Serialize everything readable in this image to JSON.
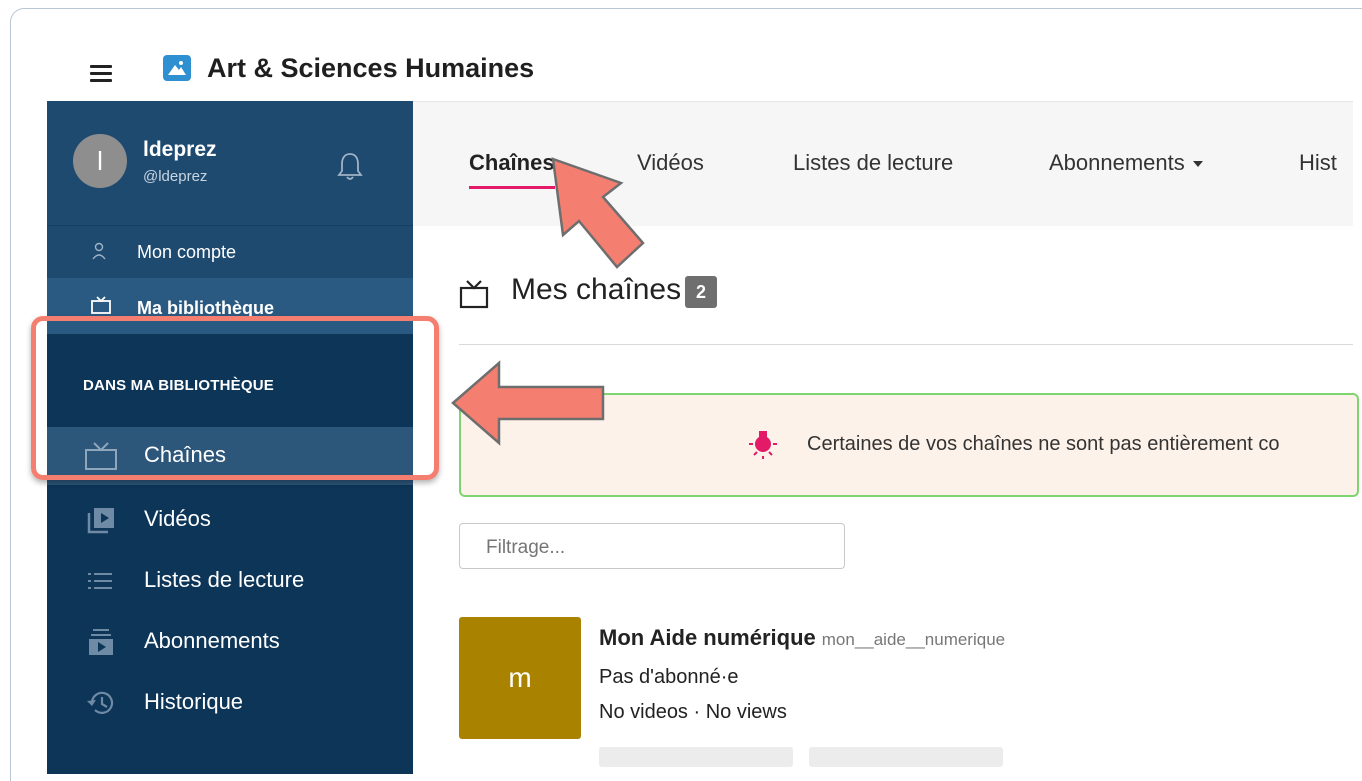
{
  "app": {
    "title": "Art & Sciences Humaines",
    "logo_icon": "mountain-image-icon",
    "menu_icon": "hamburger-icon"
  },
  "profile": {
    "avatar_letter": "l",
    "username": "ldeprez",
    "handle": "@ldeprez",
    "bell_icon": "bell-icon"
  },
  "sidebar": {
    "account_label": "Mon compte",
    "library_label": "Ma bibliothèque",
    "section_title": "DANS MA BIBLIOTHÈQUE",
    "items": [
      {
        "label": "Chaînes",
        "icon": "tv-icon",
        "active": true
      },
      {
        "label": "Vidéos",
        "icon": "video-library-icon",
        "active": false
      },
      {
        "label": "Listes de lecture",
        "icon": "list-icon",
        "active": false
      },
      {
        "label": "Abonnements",
        "icon": "subscriptions-icon",
        "active": false
      },
      {
        "label": "Historique",
        "icon": "history-icon",
        "active": false
      }
    ]
  },
  "tabs": [
    {
      "label": "Chaînes",
      "active": true
    },
    {
      "label": "Vidéos",
      "active": false
    },
    {
      "label": "Listes de lecture",
      "active": false
    },
    {
      "label": "Abonnements",
      "active": false,
      "dropdown": true
    },
    {
      "label": "Hist",
      "active": false
    }
  ],
  "main": {
    "title": "Mes chaînes",
    "count": "2",
    "alert_text": "Certaines de vos chaînes ne sont pas entièrement co",
    "filter_placeholder": "Filtrage...",
    "channel": {
      "avatar_letter": "m",
      "name": "Mon Aide numérique",
      "slug": "mon__aide__numerique",
      "subscribers": "Pas d'abonné·e",
      "stats": "No videos · No views"
    }
  },
  "colors": {
    "sidebar_bg": "#0d3558",
    "accent": "#e21a67",
    "annotation": "#f47f70",
    "channel_avatar": "#a98300"
  }
}
